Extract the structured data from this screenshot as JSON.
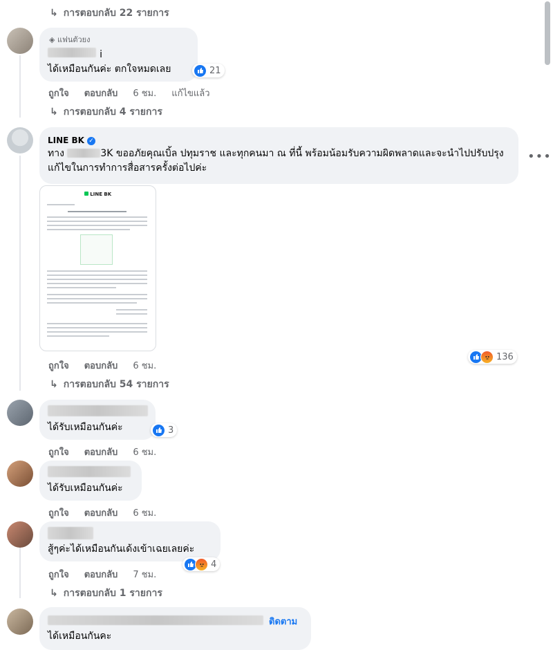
{
  "replies_22": "การตอบกลับ 22 รายการ",
  "c1": {
    "badge": "แฟนตัวยง",
    "text": "ได้เหมือนกันค่ะ ตกใจหมดเลย",
    "reactions": "21",
    "like": "ถูกใจ",
    "reply": "ตอบกลับ",
    "time": "6 ชม.",
    "edited": "แก้ไขแล้ว",
    "more_replies": "การตอบกลับ 4 รายการ"
  },
  "c2": {
    "name": "LINE BK",
    "text_pre": "ทาง",
    "text_frag": "3K",
    "text_post": " ขออภัยคุณเบิ้ล ปทุมราช และทุกคนมา ณ ที่นี้ พร้อมน้อมรับความผิดพลาดและจะนำไปปรับปรุงแก้ไขในการทำการสื่อสารครั้งต่อไปค่ะ",
    "doc_brand": "LINE BK",
    "reactions": "136",
    "like": "ถูกใจ",
    "reply": "ตอบกลับ",
    "time": "6 ชม.",
    "more_replies": "การตอบกลับ 54 รายการ"
  },
  "c3": {
    "text": "ได้รับเหมือนกันค่ะ",
    "reactions": "3",
    "like": "ถูกใจ",
    "reply": "ตอบกลับ",
    "time": "6 ชม."
  },
  "c4": {
    "text": "ได้รับเหมือนกันค่ะ",
    "like": "ถูกใจ",
    "reply": "ตอบกลับ",
    "time": "6 ชม."
  },
  "c5": {
    "text": "สู้ๆค่ะได้เหมือนกันเด้งเข้าเฉยเลยค่ะ",
    "reactions": "4",
    "like": "ถูกใจ",
    "reply": "ตอบกลับ",
    "time": "7 ชม.",
    "more_replies": "การตอบกลับ 1 รายการ"
  },
  "c6": {
    "follow": "ติดตาม",
    "text": "ได้เหมือนกันคะ"
  },
  "more_icon": "•••",
  "colors": {
    "accent": "#1877f2",
    "bubble": "#f0f2f5",
    "muted": "#65676b"
  }
}
